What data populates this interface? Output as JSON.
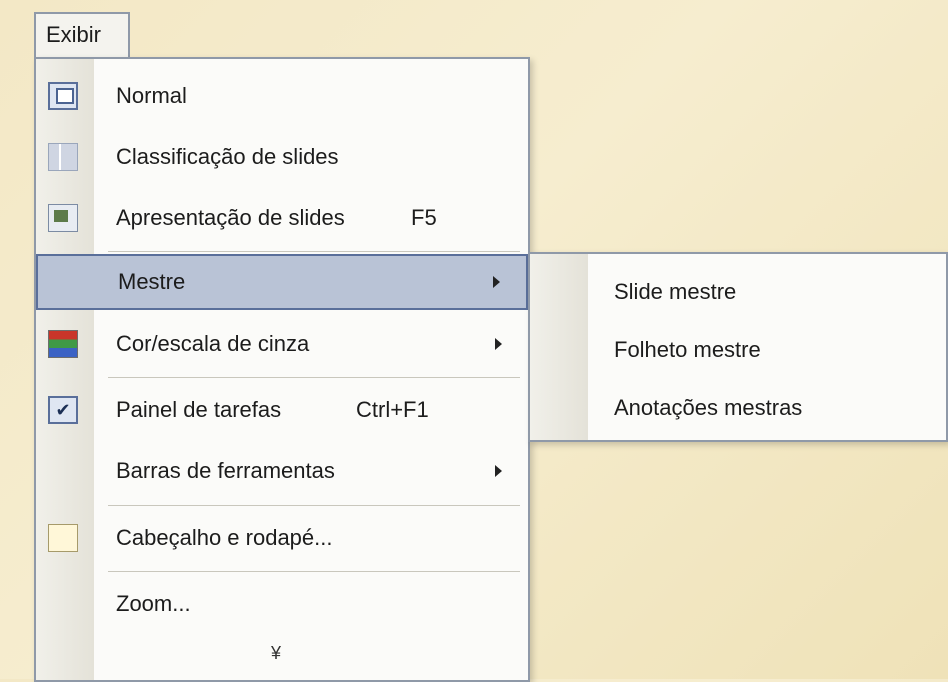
{
  "menubar": {
    "tab_label": "Exibir"
  },
  "menu": {
    "items": [
      {
        "label": "Normal",
        "icon": "normal-view-icon"
      },
      {
        "label": "Classificação de slides",
        "icon": "slide-sorter-icon"
      },
      {
        "label": "Apresentação de slides",
        "shortcut": "F5",
        "icon": "slide-show-icon"
      },
      {
        "label": "Mestre",
        "has_submenu": true,
        "highlighted": true
      },
      {
        "label": "Cor/escala de cinza",
        "has_submenu": true,
        "icon": "color-grayscale-icon"
      },
      {
        "label": "Painel de tarefas",
        "shortcut": "Ctrl+F1",
        "checked": true,
        "icon": "checkmark-icon"
      },
      {
        "label": "Barras de ferramentas",
        "has_submenu": true
      },
      {
        "label": "Cabeçalho e rodapé...",
        "icon": "header-footer-icon"
      },
      {
        "label": "Zoom..."
      }
    ],
    "expand_glyph": "¥"
  },
  "submenu": {
    "items": [
      {
        "label": "Slide mestre"
      },
      {
        "label": "Folheto mestre"
      },
      {
        "label": "Anotações mestras"
      }
    ]
  }
}
